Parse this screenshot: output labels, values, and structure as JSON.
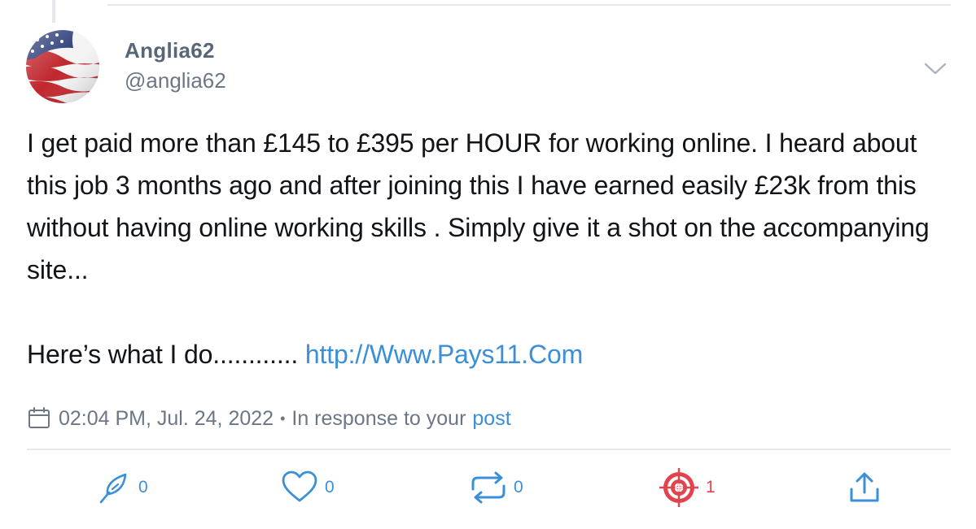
{
  "author": {
    "display_name": "Anglia62",
    "handle": "@anglia62",
    "avatar": "us-flag-avatar"
  },
  "post": {
    "paragraph1": "I get paid more than £145 to £395 per HOUR for working online. I heard about this job 3 months ago and after joining this I have earned easily £23k from this without having online working skills . Simply give it a shot on the accompanying site...",
    "paragraph2_text": "Here’s what I do............ ",
    "link_text": "http://Www.Pays11.Com"
  },
  "meta": {
    "timestamp": "02:04 PM, Jul. 24, 2022",
    "separator": "•",
    "response_text": "In response to your",
    "response_link": "post"
  },
  "actions": {
    "reply": {
      "icon": "feather-icon",
      "count": "0"
    },
    "like": {
      "icon": "heart-icon",
      "count": "0"
    },
    "repost": {
      "icon": "repost-icon",
      "count": "0"
    },
    "target": {
      "icon": "target-icon",
      "count": "1"
    },
    "share": {
      "icon": "share-icon"
    }
  },
  "colors": {
    "accent": "#3b8fd9",
    "alert": "#e2434d",
    "muted": "#6b7785"
  }
}
